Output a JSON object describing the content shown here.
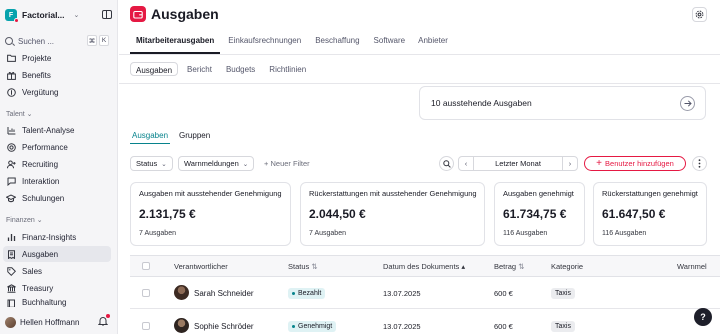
{
  "sidebar": {
    "workspace_name": "Factorial...",
    "workspace_initial": "F",
    "search": {
      "label": "Suchen ...",
      "shortcut_1": "⌘",
      "shortcut_2": "K"
    },
    "top_items": [
      {
        "label": "Projekte"
      },
      {
        "label": "Benefits"
      },
      {
        "label": "Vergütung"
      }
    ],
    "section_talent": "Talent",
    "talent_items": [
      {
        "label": "Talent-Analyse"
      },
      {
        "label": "Performance"
      },
      {
        "label": "Recruiting"
      },
      {
        "label": "Interaktion"
      },
      {
        "label": "Schulungen"
      }
    ],
    "section_finance": "Finanzen",
    "finance_items": [
      {
        "label": "Finanz-Insights"
      },
      {
        "label": "Ausgaben"
      },
      {
        "label": "Sales"
      },
      {
        "label": "Treasury"
      },
      {
        "label": "Buchhaltung"
      }
    ],
    "user_name": "Hellen Hoffmann"
  },
  "header": {
    "title": "Ausgaben"
  },
  "tabs_primary": [
    {
      "label": "Mitarbeiterausgaben"
    },
    {
      "label": "Einkaufsrechnungen"
    },
    {
      "label": "Beschaffung"
    },
    {
      "label": "Software"
    },
    {
      "label": "Anbieter"
    }
  ],
  "tabs_secondary": [
    {
      "label": "Ausgaben"
    },
    {
      "label": "Bericht"
    },
    {
      "label": "Budgets"
    },
    {
      "label": "Richtlinien"
    }
  ],
  "pending_card": {
    "text": "10 ausstehende Ausgaben"
  },
  "tabs_tertiary": [
    {
      "label": "Ausgaben"
    },
    {
      "label": "Gruppen"
    }
  ],
  "filters": {
    "status": "Status",
    "warnings": "Warnmeldungen",
    "add_filter": "Neuer Filter",
    "period": "Letzter Monat",
    "add_user": "Benutzer hinzufügen"
  },
  "metrics": [
    {
      "title": "Ausgaben mit ausstehender Genehmigung",
      "value": "2.131,75 €",
      "sub": "7 Ausgaben"
    },
    {
      "title": "Rückerstattungen mit ausstehender Genehmigung",
      "value": "2.044,50 €",
      "sub": "7 Ausgaben"
    },
    {
      "title": "Ausgaben genehmigt",
      "value": "61.734,75 €",
      "sub": "116 Ausgaben"
    },
    {
      "title": "Rückerstattungen genehmigt",
      "value": "61.647,50 €",
      "sub": "116 Ausgaben"
    }
  ],
  "table": {
    "columns": {
      "owner": "Verantwortlicher",
      "status": "Status",
      "date": "Datum des Dokuments",
      "amount": "Betrag",
      "category": "Kategorie",
      "warnings": "Warnmel"
    },
    "rows": [
      {
        "name": "Sarah Schneider",
        "status": "Bezahlt",
        "date": "13.07.2025",
        "amount": "600 €",
        "category": "Taxis"
      },
      {
        "name": "Sophie Schröder",
        "status": "Genehmigt",
        "date": "13.07.2025",
        "amount": "600 €",
        "category": "Taxis"
      }
    ]
  },
  "help": {
    "label": "?"
  },
  "colors": {
    "accent": "#e51943",
    "teal": "#07838c",
    "sidebar_bg": "#f5f5f7"
  }
}
